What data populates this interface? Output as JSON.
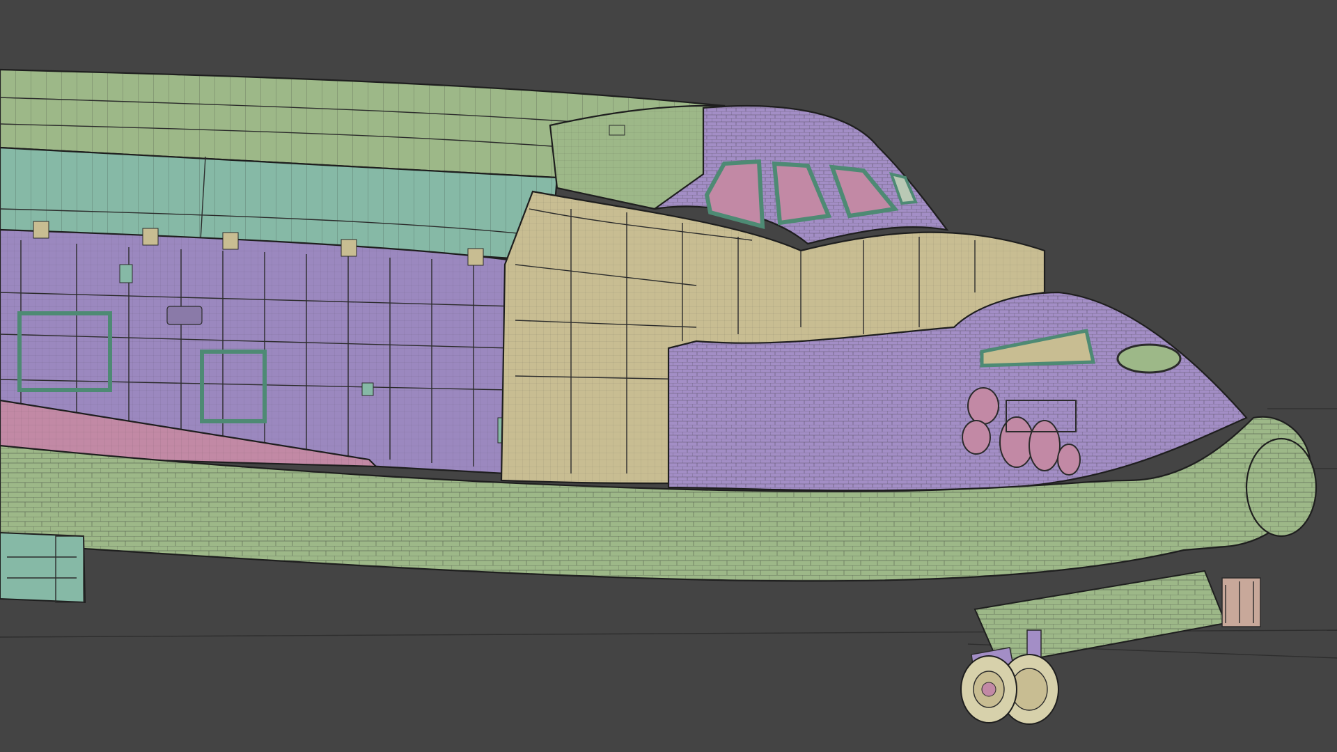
{
  "viewport": {
    "background": "#444444"
  },
  "model": {
    "colors": {
      "green": "#9db888",
      "green_dark": "#8aa677",
      "lavender": "#9b88bf",
      "lavender_light": "#a38ec6",
      "teal": "#86b9a6",
      "tan": "#c8bd92",
      "pink": "#c289a5",
      "cream": "#d7d1ab",
      "wire": "#2b2b2b"
    }
  }
}
